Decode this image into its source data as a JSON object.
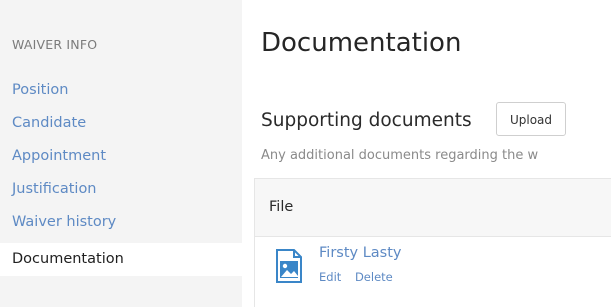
{
  "sidebar": {
    "heading": "WAIVER INFO",
    "items": [
      {
        "label": "Position",
        "active": false
      },
      {
        "label": "Candidate",
        "active": false
      },
      {
        "label": "Appointment",
        "active": false
      },
      {
        "label": "Justification",
        "active": false
      },
      {
        "label": "Waiver history",
        "active": false
      },
      {
        "label": "Documentation",
        "active": true
      }
    ]
  },
  "main": {
    "title": "Documentation",
    "section_title": "Supporting documents",
    "upload_label": "Upload",
    "helper_text": "Any additional documents regarding the w",
    "table": {
      "column_header": "File",
      "rows": [
        {
          "name": "Firsty Lasty",
          "edit_label": "Edit",
          "delete_label": "Delete",
          "icon": "image-file-icon"
        }
      ]
    }
  },
  "colors": {
    "link": "#5e8ac4",
    "sidebar_bg": "#f4f4f4",
    "text": "#262626"
  }
}
